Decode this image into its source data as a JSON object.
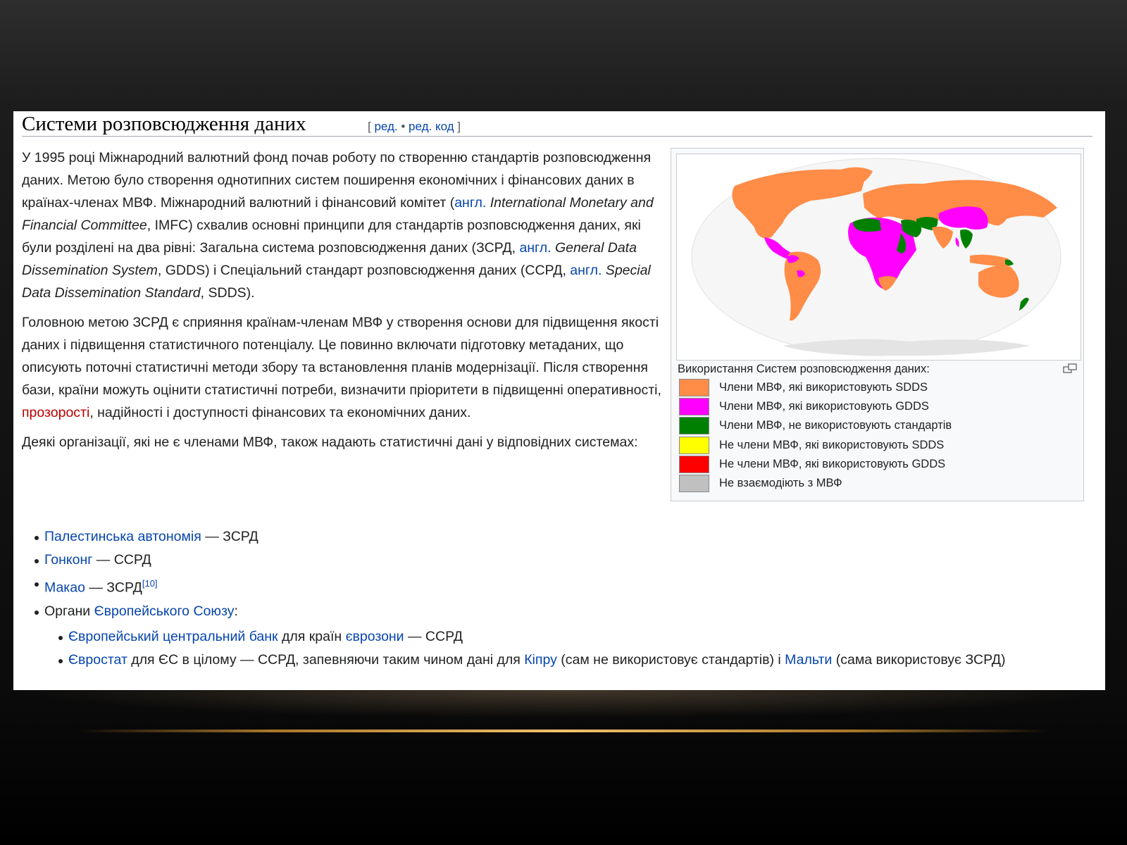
{
  "heading": {
    "title": "Системи розповсюдження даних",
    "edit_open": "[ ",
    "edit_label": "ред.",
    "edit_sep": " • ",
    "edit_code_label": "ред. код",
    "edit_close": " ]"
  },
  "paragraphs": [
    {
      "t1": "У 1995 році Міжнародний валютний фонд почав роботу по створенню стандартів розповсюдження даних. Метою було створення однотипних систем поширення економічних і фінансових даних в країнах-членах МВФ. Міжнародний валютний і фінансовий комітет (",
      "l1": "англ.",
      "i1": " International Monetary and Financial Committee",
      "t2": ", IMFC) схвалив основні принципи для стандартів розповсюдження даних, які були розділені на два рівні: Загальна система розповсюдження даних (ЗСРД, ",
      "l2": "англ.",
      "i2": " General Data Dissemination System",
      "t3": ", GDDS) і Спеціальний стандарт розповсюдження даних (ССРД, ",
      "l3": "англ.",
      "i3": " Special Data Dissemination Standard",
      "t4": ", SDDS)."
    },
    {
      "t1": "Головною метою ЗСРД є сприяння країнам-членам МВФ у створення основи для підвищення якості даних і підвищення статистичного потенціалу. Це повинно включати підготовку метаданих, що описують поточні статистичні методи збору та встановлення планів модернізації. Після створення бази, країни можуть оцінити статистичні потреби, визначити пріоритети в підвищенні оперативності, ",
      "red_link": "прозорості",
      "t2": ", надійності і доступності фінансових та економічних даних."
    },
    {
      "t1": "Деякі організації, які не є членами МВФ, також надають статистичні дані у відповідних системах:"
    }
  ],
  "bullets": [
    {
      "link": "Палестинська автономія",
      "text": " — ЗСРД"
    },
    {
      "link": "Гонконг",
      "text": " — ССРД"
    },
    {
      "link": "Макао",
      "text": " — ЗСРД",
      "ref": "[10]"
    },
    {
      "text": "Органи ",
      "link": "Європейського Союзу",
      "after": ":"
    }
  ],
  "sub_bullets": [
    {
      "link": "Європейський центральний банк",
      "t1": " для країн ",
      "link2": "єврозони",
      "t2": " — ССРД"
    },
    {
      "link": "Євростат",
      "t1": " для ЄС в цілому — ССРД, запевняючи таким чином дані для ",
      "link2": "Кіпру",
      "t2": " (сам не використовує стандартів) і ",
      "link3": "Мальти",
      "t3": " (сама використовує ЗСРД)"
    }
  ],
  "figure": {
    "caption": "Використання Систем розповсюдження даних:",
    "legend": [
      {
        "label": "Члени МВФ, які використовують SDDS",
        "color": "#ff8c47"
      },
      {
        "label": "Члени МВФ, які використовують GDDS",
        "color": "#ff00ff"
      },
      {
        "label": "Члени МВФ, не використовують стандартів",
        "color": "#008000"
      },
      {
        "label": "Не члени МВФ, які використовують SDDS",
        "color": "#ffff00"
      },
      {
        "label": "Не члени МВФ, які використовують GDDS",
        "color": "#ff0000"
      },
      {
        "label": "Не взаємодіють з МВФ",
        "color": "#c0c0c0"
      }
    ]
  }
}
